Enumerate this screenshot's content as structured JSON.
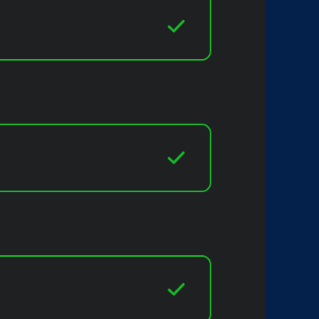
{
  "colors": {
    "panel_background": "#1f2022",
    "side_background": "#03214a",
    "valid_accent": "#19b52a"
  },
  "fields": [
    {
      "state": "valid",
      "icon": "checkmark-icon",
      "value": ""
    },
    {
      "state": "valid",
      "icon": "checkmark-icon",
      "value": ""
    },
    {
      "state": "valid",
      "icon": "checkmark-icon",
      "value": ""
    }
  ]
}
